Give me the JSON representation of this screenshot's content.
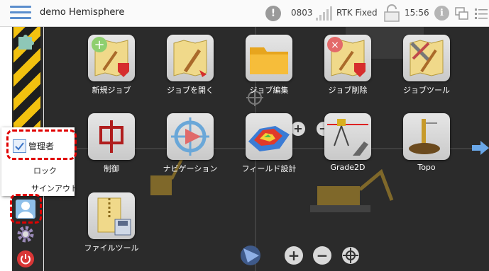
{
  "header": {
    "app_title": "demo Hemisphere",
    "warning_code": "0803",
    "rtk_status": "RTK Fixed",
    "time": "15:56",
    "info_glyph": "i",
    "warning_glyph": "!"
  },
  "apps": [
    {
      "label": "新規ジョブ",
      "icon": "new-job-icon"
    },
    {
      "label": "ジョブを開く",
      "icon": "open-job-icon"
    },
    {
      "label": "ジョブ編集",
      "icon": "edit-job-icon"
    },
    {
      "label": "ジョブ削除",
      "icon": "delete-job-icon"
    },
    {
      "label": "ジョブツール",
      "icon": "job-tools-icon"
    },
    {
      "label": "制御",
      "icon": "control-icon"
    },
    {
      "label": "ナビゲーション",
      "icon": "navigation-icon"
    },
    {
      "label": "フィールド設計",
      "icon": "field-design-icon"
    },
    {
      "label": "Grade2D",
      "icon": "grade2d-icon"
    },
    {
      "label": "Topo",
      "icon": "topo-icon"
    },
    {
      "label": "ファイルツール",
      "icon": "file-tools-icon"
    }
  ],
  "user_menu": {
    "role": "管理者",
    "lock": "ロック",
    "sign_out": "サインアウト"
  },
  "map_controls": {
    "zoom_in": "+",
    "zoom_out": "−"
  },
  "colors": {
    "highlight": "#e00000",
    "accent": "#5b8ecd",
    "background": "#2b2b2b",
    "stripe_yellow": "#f2c10f"
  }
}
